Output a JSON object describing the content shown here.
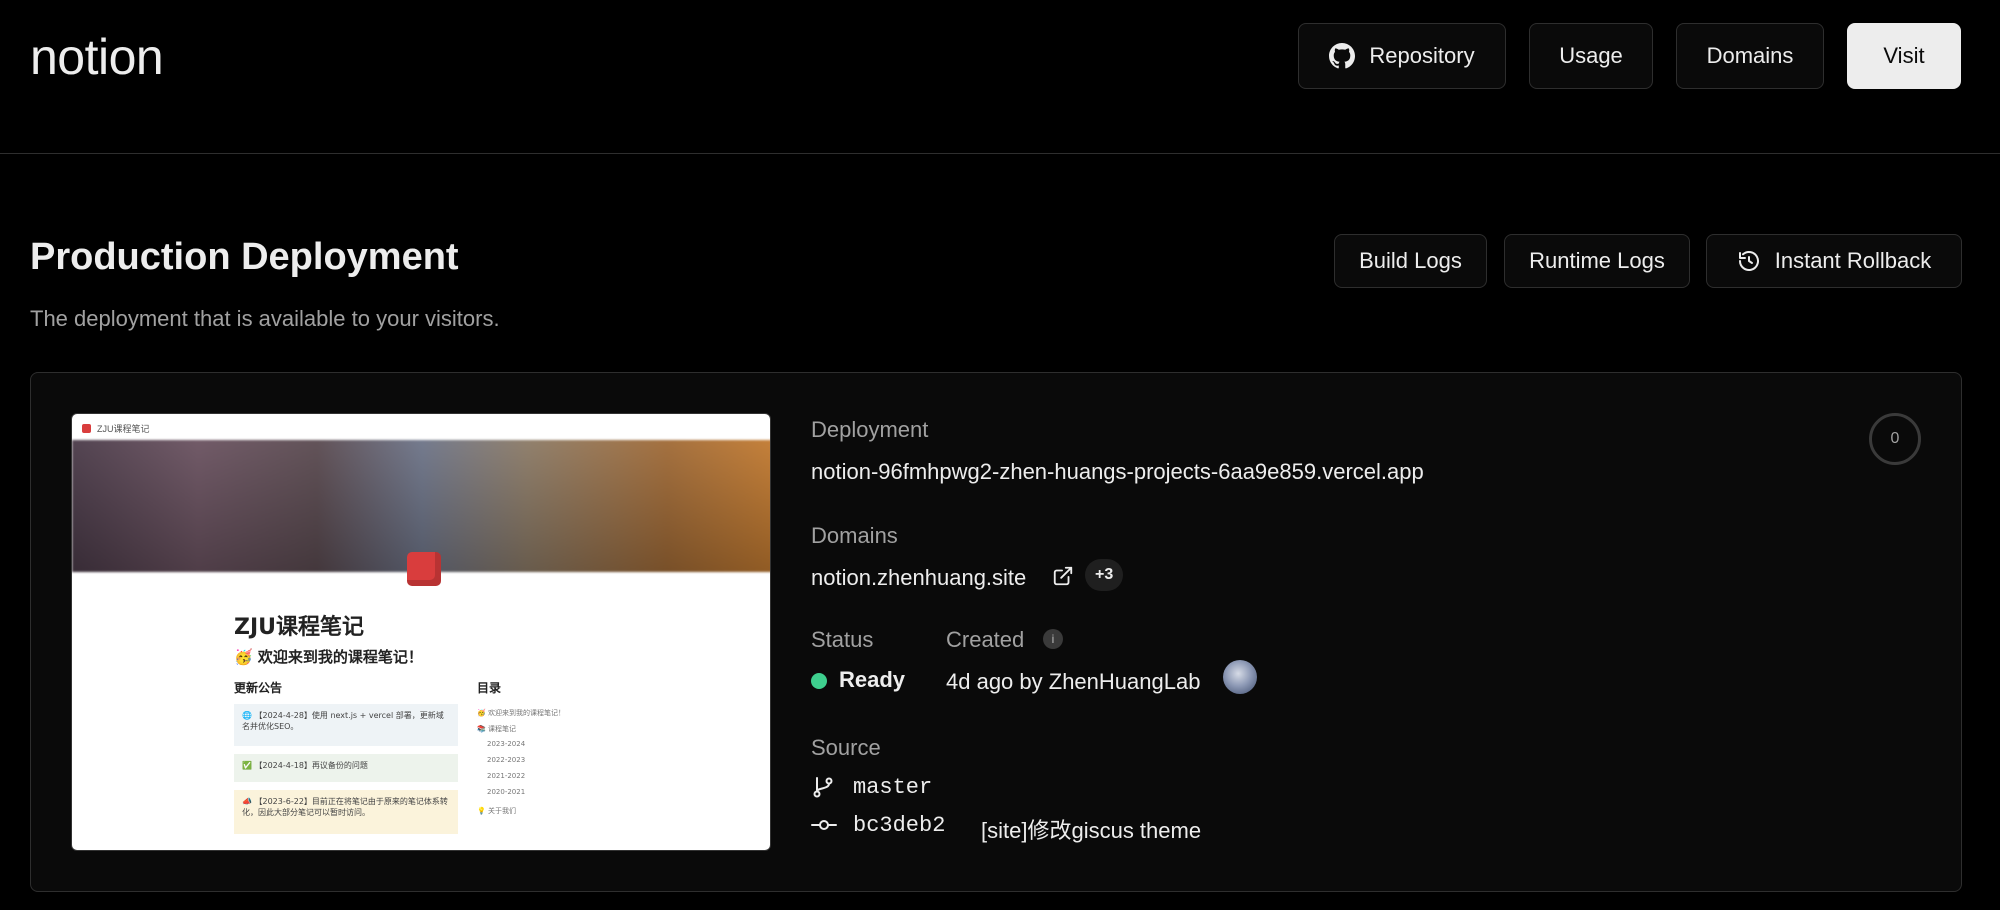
{
  "header": {
    "project_name": "notion",
    "repository_label": "Repository",
    "usage_label": "Usage",
    "domains_label": "Domains",
    "visit_label": "Visit"
  },
  "section": {
    "title": "Production Deployment",
    "subtitle": "The deployment that is available to your visitors.",
    "build_logs_label": "Build Logs",
    "runtime_logs_label": "Runtime Logs",
    "rollback_label": "Instant Rollback"
  },
  "preview": {
    "tab_title": "ZJU课程笔记",
    "page_title": "ZJU课程笔记",
    "welcome": "🥳 欢迎来到我的课程笔记！",
    "updates_heading": "更新公告",
    "toc_heading": "目录",
    "updates": [
      "🌐 【2024-4-28】使用 next.js + vercel 部署，更新域名并优化SEO。",
      "✅ 【2024-4-18】再议备份的问题",
      "📣 【2023-6-22】目前正在将笔记由于原来的笔记体系转化，因此大部分笔记可以暂时访问。"
    ],
    "toc_items": [
      "🥳 欢迎来到我的课程笔记！",
      "📚 课程笔记",
      "2023-2024",
      "2022-2023",
      "2021-2022",
      "2020-2021",
      "💡 关于我们"
    ]
  },
  "deployment": {
    "deployment_label": "Deployment",
    "deployment_url": "notion-96fmhpwg2-zhen-huangs-projects-6aa9e859.vercel.app",
    "domains_label": "Domains",
    "primary_domain": "notion.zhenhuang.site",
    "extra_domains": "+3",
    "status_label": "Status",
    "status_value": "Ready",
    "status_color": "#3ecf8e",
    "created_label": "Created",
    "created_value": "4d ago by ZhenHuangLab",
    "source_label": "Source",
    "branch": "master",
    "commit_hash": "bc3deb2",
    "commit_message": "[site]修改giscus theme",
    "ring_count": "0"
  }
}
